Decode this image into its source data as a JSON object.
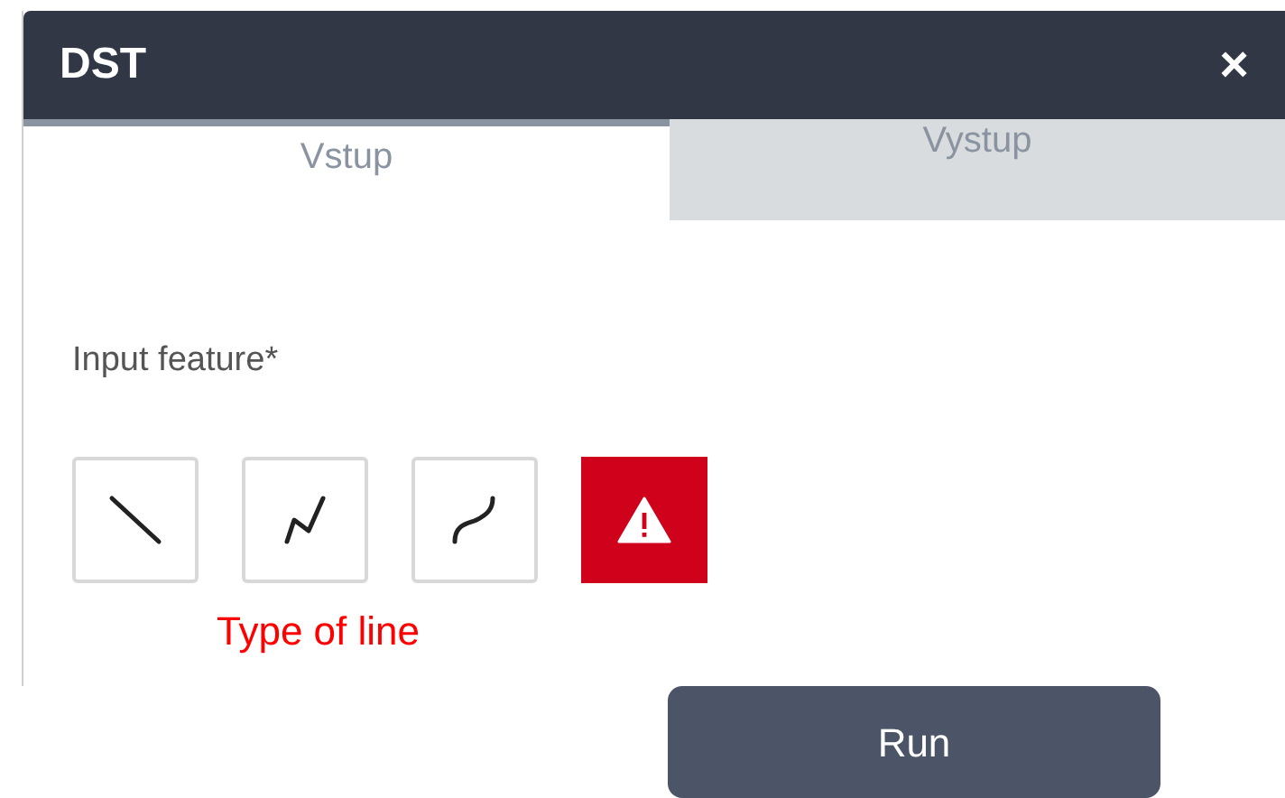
{
  "window": {
    "title": "DST",
    "close": "×"
  },
  "tabs": [
    {
      "label": "Vstup",
      "selected": true
    },
    {
      "label": "Vystup",
      "selected": false
    }
  ],
  "input_feature": {
    "label": "Input feature*"
  },
  "tools": [
    {
      "kind": "line"
    },
    {
      "kind": "polyline"
    },
    {
      "kind": "curve"
    },
    {
      "kind": "warning"
    }
  ],
  "annotation": "Type of line",
  "run_button": "Run"
}
